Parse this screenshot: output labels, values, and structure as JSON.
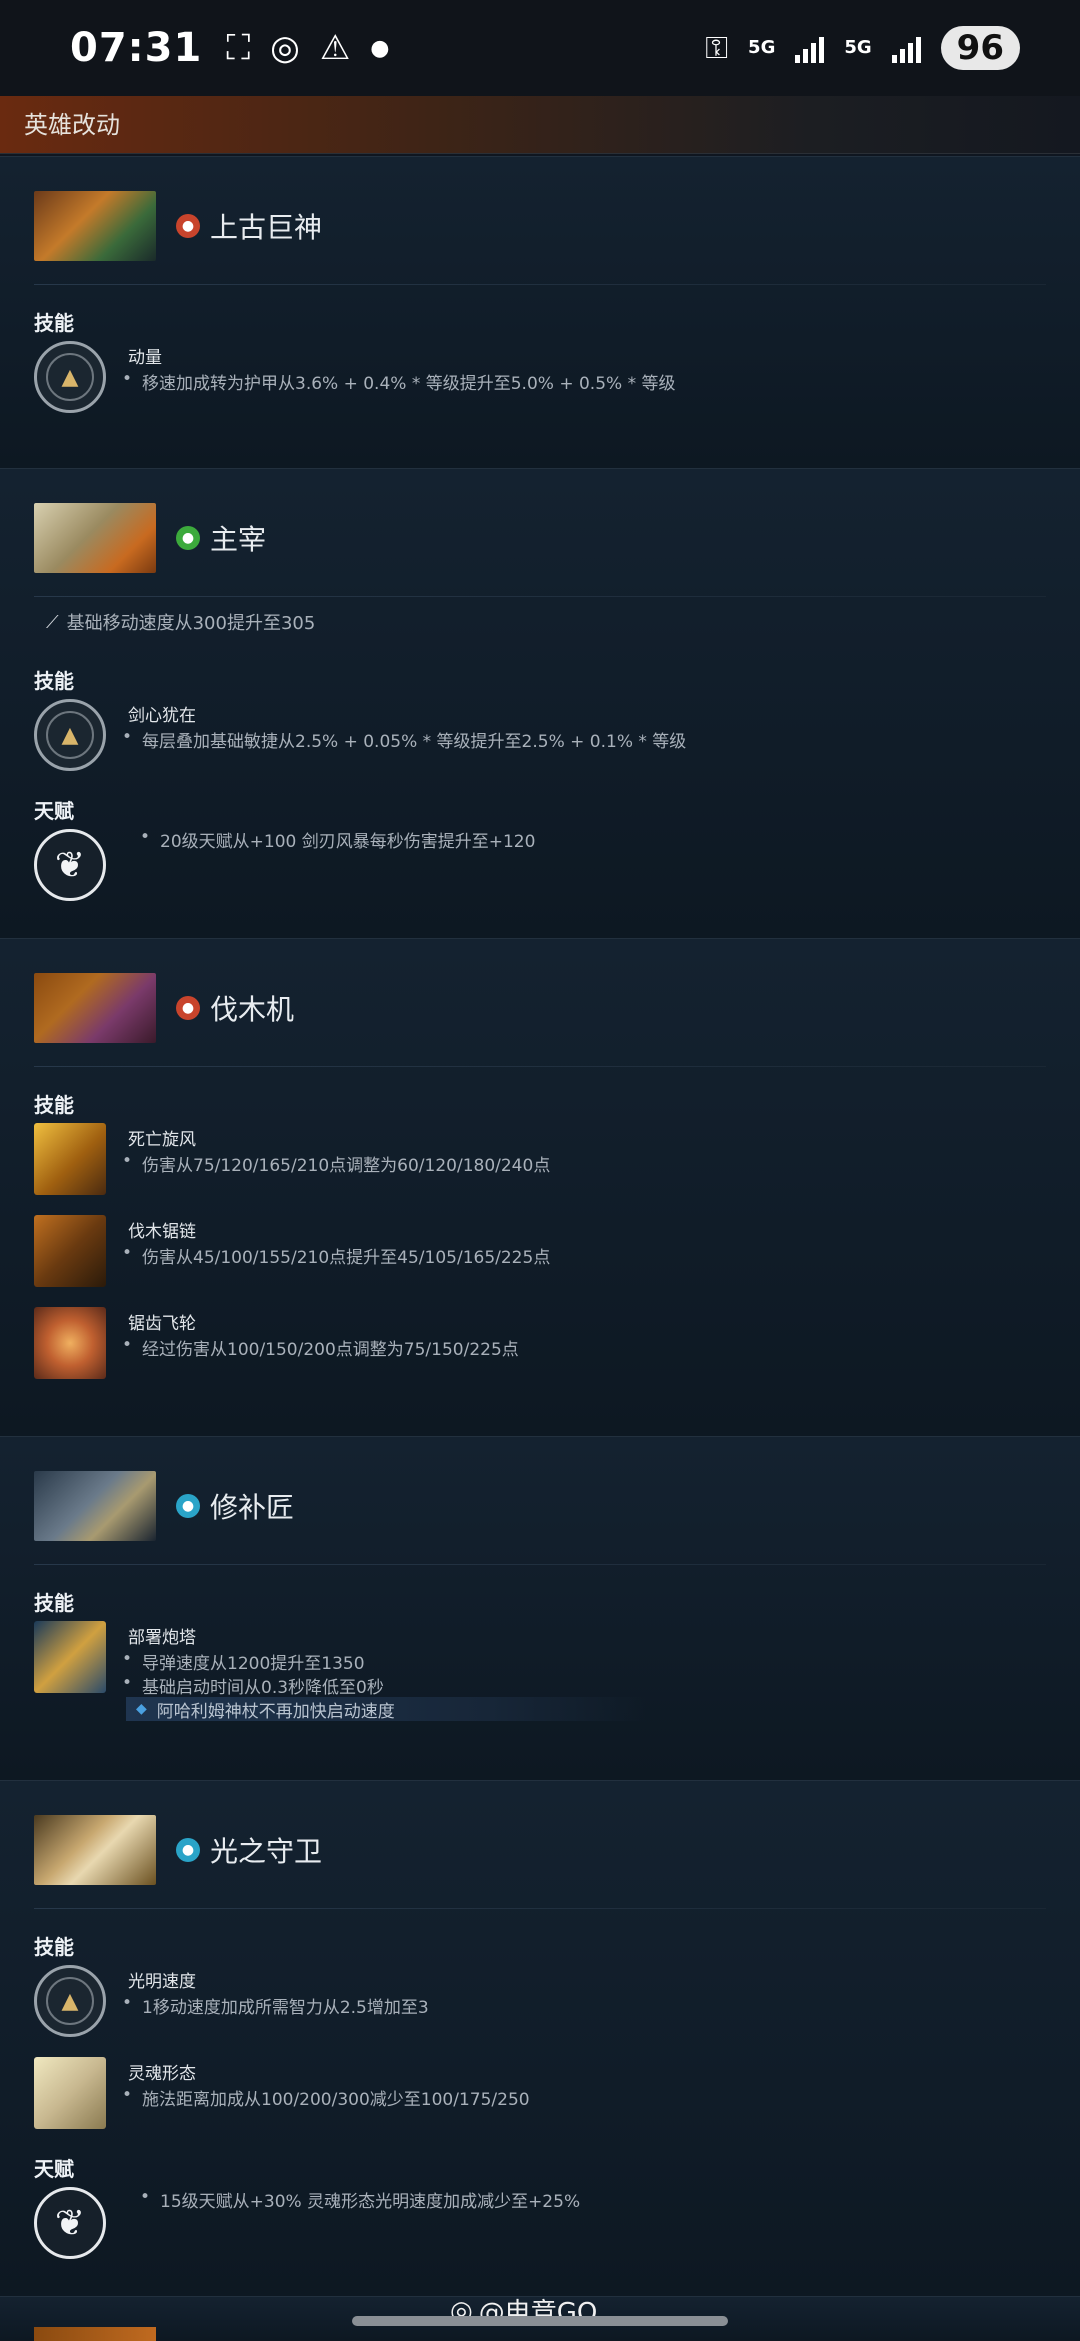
{
  "status_bar": {
    "time": "07:31",
    "net1": "5G",
    "net2": "5G",
    "battery": "96"
  },
  "section_title": "英雄改动",
  "heroes": [
    {
      "name": "上古巨神",
      "attribute_color": "#c8442c",
      "groups": [
        {
          "label": "技能",
          "abilities": [
            {
              "name": "动量",
              "notes": [
                "移速加成转为护甲从3.6% + 0.4% * 等级提升至5.0% + 0.5% * 等级"
              ]
            }
          ]
        }
      ]
    },
    {
      "name": "主宰",
      "attribute_color": "#3caa3c",
      "stat_note": "基础移动速度从300提升至305",
      "groups": [
        {
          "label": "技能",
          "abilities": [
            {
              "name": "剑心犹在",
              "notes": [
                "每层叠加基础敏捷从2.5% + 0.05% * 等级提升至2.5% + 0.1% * 等级"
              ]
            }
          ]
        },
        {
          "label": "天赋",
          "abilities": [
            {
              "name": "",
              "notes": [
                "20级天赋从+100 剑刃风暴每秒伤害提升至+120"
              ]
            }
          ]
        }
      ]
    },
    {
      "name": "伐木机",
      "attribute_color": "#c8442c",
      "groups": [
        {
          "label": "技能",
          "abilities": [
            {
              "name": "死亡旋风",
              "notes": [
                "伤害从75/120/165/210点调整为60/120/180/240点"
              ]
            },
            {
              "name": "伐木锯链",
              "notes": [
                "伤害从45/100/155/210点提升至45/105/165/225点"
              ]
            },
            {
              "name": "锯齿飞轮",
              "notes": [
                "经过伤害从100/150/200点调整为75/150/225点"
              ]
            }
          ]
        }
      ]
    },
    {
      "name": "修补匠",
      "attribute_color": "#2aa4c8",
      "groups": [
        {
          "label": "技能",
          "abilities": [
            {
              "name": "部署炮塔",
              "notes": [
                "导弹速度从1200提升至1350",
                "基础启动时间从0.3秒降低至0秒"
              ],
              "aghs_note": "阿哈利姆神杖不再加快启动速度"
            }
          ]
        }
      ]
    },
    {
      "name": "光之守卫",
      "attribute_color": "#2aa4c8",
      "groups": [
        {
          "label": "技能",
          "abilities": [
            {
              "name": "光明速度",
              "notes": [
                "1移动速度加成所需智力从2.5增加至3"
              ]
            },
            {
              "name": "灵魂形态",
              "notes": [
                "施法距离加成从100/200/300减少至100/175/250"
              ]
            }
          ]
        },
        {
          "label": "天赋",
          "abilities": [
            {
              "name": "",
              "notes": [
                "15级天赋从+30% 灵魂形态光明速度加成减少至+25%"
              ]
            }
          ]
        }
      ]
    }
  ],
  "watermark": "@电竞GO"
}
